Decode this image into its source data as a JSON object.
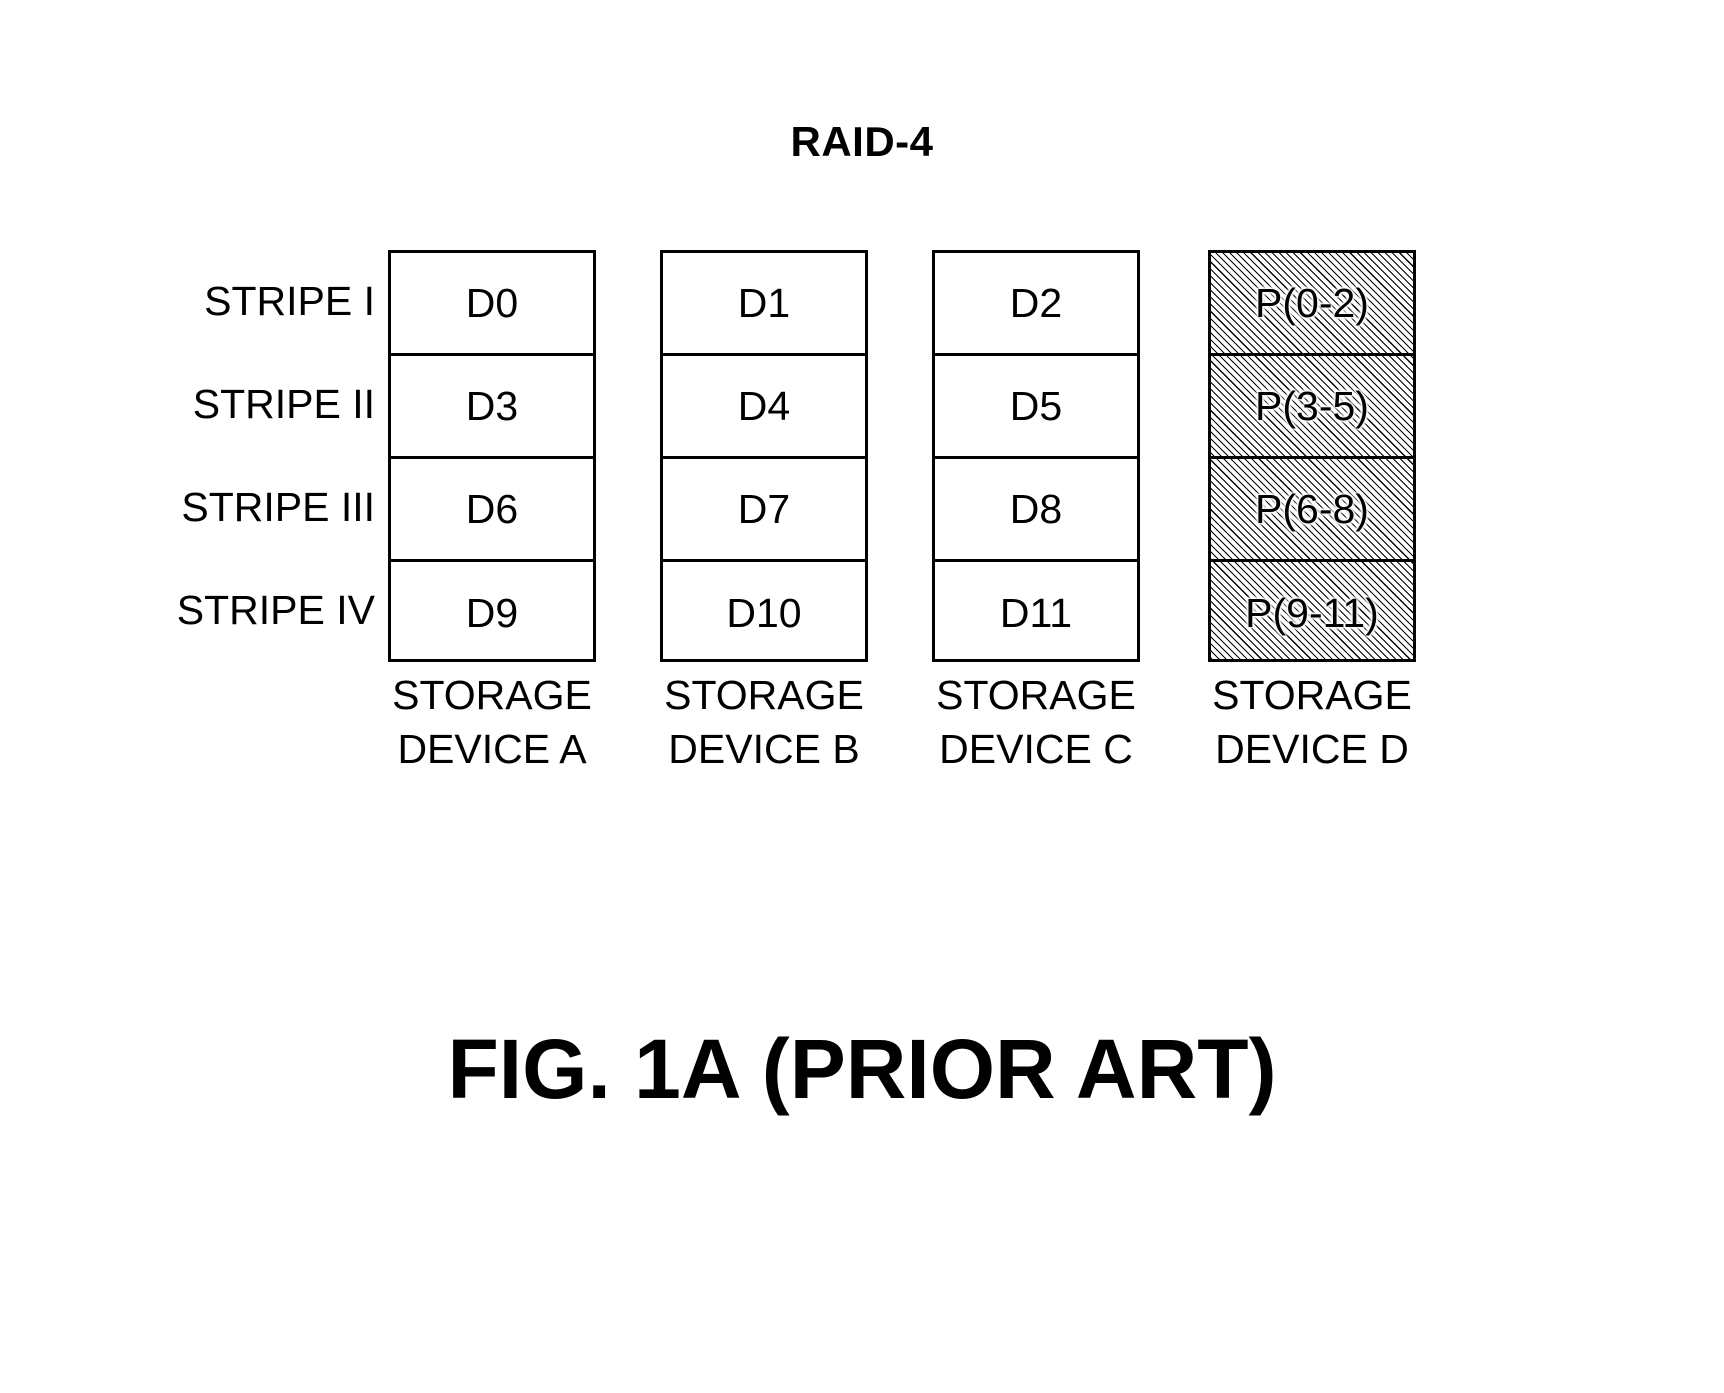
{
  "figure": {
    "title": "RAID-4",
    "caption": "FIG. 1A (PRIOR ART)"
  },
  "colors": {
    "ink": "#000000",
    "background": "#ffffff",
    "parity_fill": "#ffffff",
    "parity_hatch": "#000000"
  },
  "stripes": [
    {
      "label": "STRIPE I"
    },
    {
      "label": "STRIPE II"
    },
    {
      "label": "STRIPE III"
    },
    {
      "label": "STRIPE IV"
    }
  ],
  "columns": [
    {
      "caption_line1": "STORAGE",
      "caption_line2": "DEVICE A",
      "hatched": false,
      "cells": [
        "D0",
        "D3",
        "D6",
        "D9"
      ]
    },
    {
      "caption_line1": "STORAGE",
      "caption_line2": "DEVICE B",
      "hatched": false,
      "cells": [
        "D1",
        "D4",
        "D7",
        "D10"
      ]
    },
    {
      "caption_line1": "STORAGE",
      "caption_line2": "DEVICE C",
      "hatched": false,
      "cells": [
        "D2",
        "D5",
        "D8",
        "D11"
      ]
    },
    {
      "caption_line1": "STORAGE",
      "caption_line2": "DEVICE D",
      "hatched": true,
      "cells": [
        "P(0-2)",
        "P(3-5)",
        "P(6-8)",
        "P(9-11)"
      ]
    }
  ]
}
